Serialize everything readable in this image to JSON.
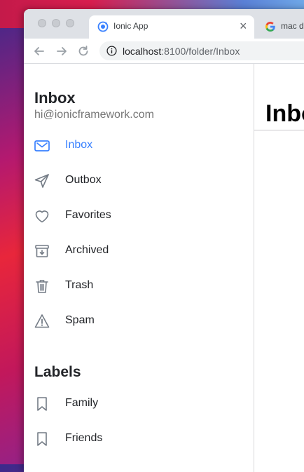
{
  "browser": {
    "active_tab": {
      "title": "Ionic App",
      "close": "×",
      "favicon": "ionic-logo-icon"
    },
    "second_tab": {
      "title": "mac d",
      "favicon": "google-g-icon"
    },
    "url": {
      "host": "localhost",
      "rest": ":8100/folder/Inbox"
    }
  },
  "menu": {
    "title": "Inbox",
    "subtitle": "hi@ionicframework.com",
    "items": [
      {
        "label": "Inbox",
        "icon": "mail-icon",
        "selected": true
      },
      {
        "label": "Outbox",
        "icon": "paper-plane-icon"
      },
      {
        "label": "Favorites",
        "icon": "heart-icon"
      },
      {
        "label": "Archived",
        "icon": "archive-icon"
      },
      {
        "label": "Trash",
        "icon": "trash-icon"
      },
      {
        "label": "Spam",
        "icon": "warning-icon"
      }
    ],
    "labels_title": "Labels",
    "labels": [
      {
        "label": "Family",
        "icon": "bookmark-icon"
      },
      {
        "label": "Friends",
        "icon": "bookmark-icon"
      }
    ]
  },
  "main": {
    "title": "Inbox"
  },
  "colors": {
    "accent": "#3880ff",
    "icon_gray": "#737b85"
  }
}
